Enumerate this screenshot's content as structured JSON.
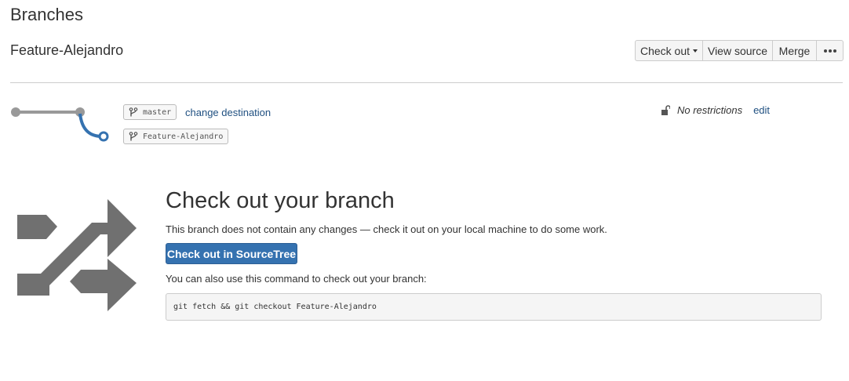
{
  "page": {
    "title": "Branches"
  },
  "branch": {
    "name": "Feature-Alejandro"
  },
  "toolbar": {
    "checkout_label": "Check out",
    "view_source_label": "View source",
    "merge_label": "Merge",
    "more_icon": "ellipsis-icon"
  },
  "graph": {
    "source_branch": "master",
    "destination_branch": "Feature-Alejandro",
    "change_destination_label": "change destination",
    "colors": {
      "mainline": "#999999",
      "branch": "#3572b0"
    }
  },
  "restrictions": {
    "icon": "unlock-icon",
    "text": "No restrictions",
    "edit_label": "edit"
  },
  "checkout_panel": {
    "icon": "shuffle-arrows-icon",
    "title": "Check out your branch",
    "description": "This branch does not contain any changes — check it out on your local machine to do some work.",
    "button_label": "Check out in SourceTree",
    "also_text": "You can also use this command to check out your branch:",
    "command": "git fetch && git checkout Feature-Alejandro"
  },
  "colors": {
    "accent": "#3572b0",
    "link": "#205081",
    "icon_gray": "#707070"
  }
}
